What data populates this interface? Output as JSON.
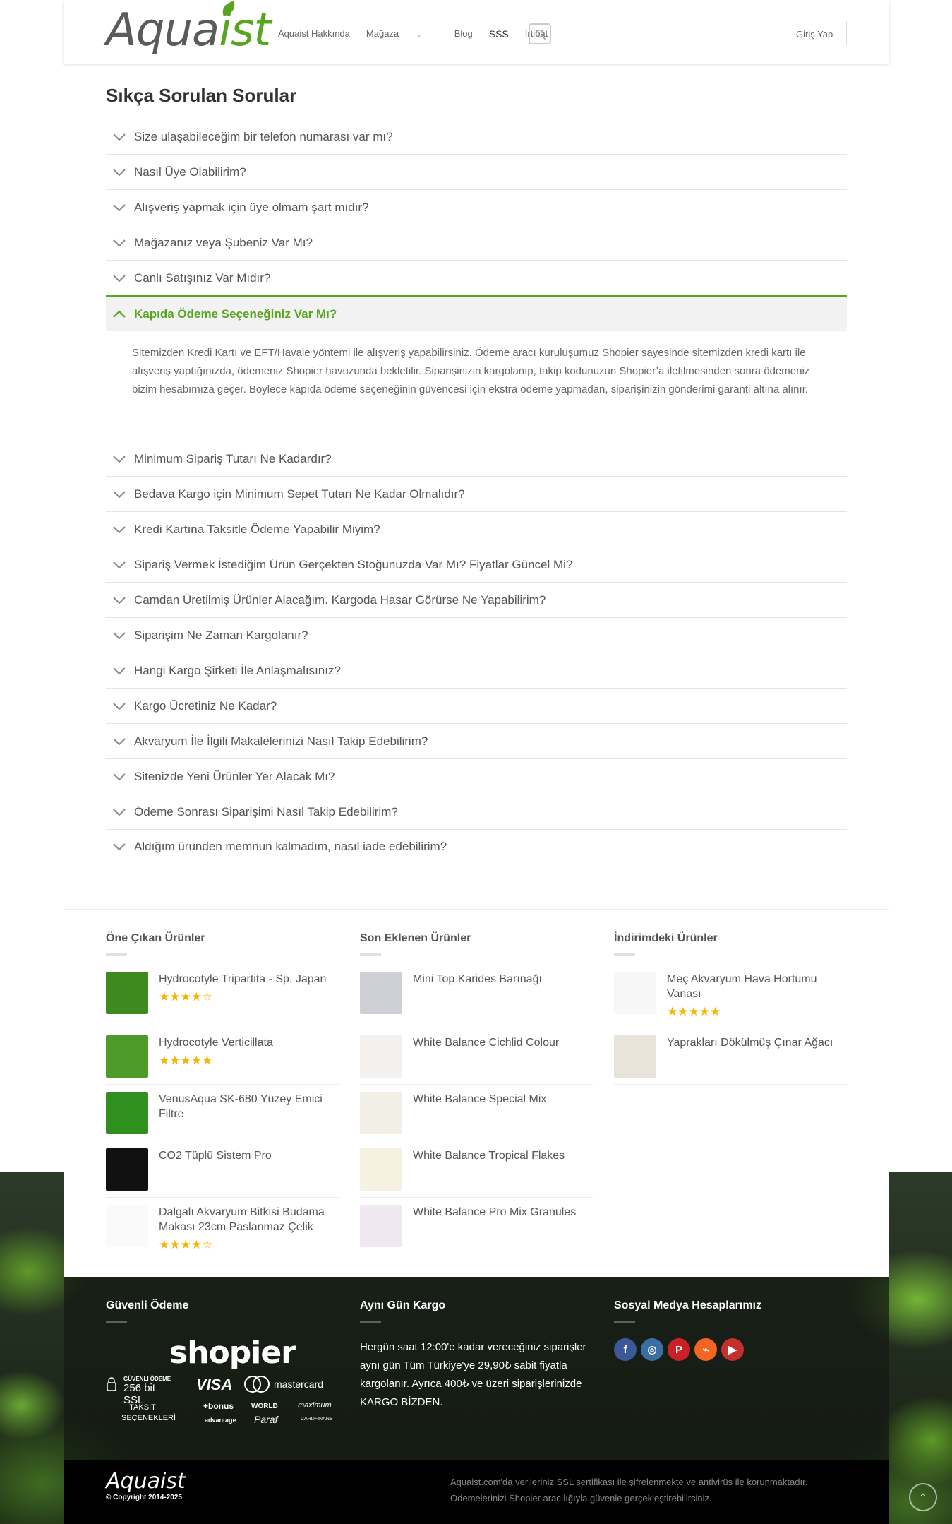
{
  "header": {
    "logo_text_a": "Aqua",
    "logo_text_b": "ist",
    "nav": [
      "Aquaist Hakkında",
      "Mağaza",
      "Blog",
      "SSS",
      "İrtibat"
    ],
    "login": "Giriş Yap"
  },
  "faq": {
    "title": "Sıkça Sorulan Sorular",
    "items_before": [
      "Size ulaşabileceğim bir telefon numarası var mı?",
      "Nasıl Üye Olabilirim?",
      "Alışveriş yapmak için üye olmam şart mıdır?",
      "Mağazanız veya Şubeniz Var Mı?",
      "Canlı Satışınız Var Mıdır?"
    ],
    "open_item": "Kapıda Ödeme Seçeneğiniz Var Mı?",
    "open_answer": "Sitemizden Kredi Kartı ve EFT/Havale yöntemi ile alışveriş yapabilirsiniz. Ödeme aracı kuruluşumuz Shopier sayesinde sitemizden kredi kartı ile alışveriş yaptığınızda, ödemeniz Shopier havuzunda bekletilir. Siparişinizin kargolanıp, takip kodunuzun Shopier’a iletilmesinden sonra ödemeniz bizim hesabımıza geçer. Böylece kapıda ödeme seçeneğinin güvencesi için ekstra ödeme yapmadan, siparişinizin gönderimi garanti altına alınır.",
    "items_after": [
      "Minimum Sipariş Tutarı Ne Kadardır?",
      "Bedava Kargo için Minimum Sepet Tutarı Ne Kadar Olmalıdır?",
      "Kredi Kartına Taksitle Ödeme Yapabilir Miyim?",
      "Sipariş Vermek İstediğim Ürün Gerçekten Stoğunuzda Var Mı? Fiyatlar Güncel Mi?",
      "Camdan Üretilmiş Ürünler Alacağım. Kargoda Hasar Görürse Ne Yapabilirim?",
      "Siparişim Ne Zaman Kargolanır?",
      "Hangi Kargo Şirketi İle Anlaşmalısınız?",
      "Kargo Ücretiniz Ne Kadar?",
      "Akvaryum İle İlgili Makalelerinizi Nasıl Takip Edebilirim?",
      "Sitenizde Yeni Ürünler Yer Alacak Mı?",
      "Ödeme Sonrası Siparişimi Nasıl Takip Edebilirim?",
      "Aldığım üründen memnun kalmadım, nasıl iade edebilirim?"
    ]
  },
  "widgets": {
    "featured": {
      "title": "Öne Çıkan Ürünler",
      "items": [
        {
          "name": "Hydrocotyle Tripartita - Sp. Japan",
          "rating": 4
        },
        {
          "name": "Hydrocotyle Verticillata",
          "rating": 5
        },
        {
          "name": "VenusAqua SK-680 Yüzey Emici Filtre",
          "rating": 0
        },
        {
          "name": "CO2 Tüplü Sistem Pro",
          "rating": 0
        },
        {
          "name": "Dalgalı Akvaryum Bitkisi Budama Makası 23cm Paslanmaz Çelik",
          "rating": 4
        }
      ]
    },
    "recent": {
      "title": "Son Eklenen Ürünler",
      "items": [
        {
          "name": "Mini Top Karides Barınağı"
        },
        {
          "name": "White Balance Cichlid Colour"
        },
        {
          "name": "White Balance Special Mix"
        },
        {
          "name": "White Balance Tropical Flakes"
        },
        {
          "name": "White Balance Pro Mix Granules"
        }
      ]
    },
    "sale": {
      "title": "İndirimdeki Ürünler",
      "items": [
        {
          "name": "Meç Akvaryum Hava Hortumu Vanası",
          "rating": 5
        },
        {
          "name": "Yaprakları Dökülmüş Çınar Ağacı",
          "rating": 0
        }
      ]
    }
  },
  "footer": {
    "secure_title": "Güvenli Ödeme",
    "shopier": "shopier",
    "ssl_small": "GÜVENLİ ÖDEME",
    "ssl_big": "256 bit SSL",
    "visa": "VISA",
    "mastercard": "mastercard",
    "taksit": "TAKSİT SEÇENEKLERİ",
    "cards": [
      "+bonus",
      "WORLD",
      "maximum",
      "advantage",
      "Paraf",
      "CARDFINANS"
    ],
    "cargo_title": "Aynı Gün Kargo",
    "cargo_text": "Hergün saat 12:00'e kadar vereceğiniz siparişler aynı gün Tüm Türkiye'ye 29,90₺ sabit fiyatla kargolanır. Ayrıca 400₺ ve üzeri siparişlerinizde KARGO BİZDEN.",
    "social_title": "Sosyal Medya Hesaplarımız",
    "social": [
      {
        "icon": "facebook-icon",
        "glyph": "f",
        "color": "#3b5998"
      },
      {
        "icon": "instagram-icon",
        "glyph": "◎",
        "color": "#3b6ea5"
      },
      {
        "icon": "pinterest-icon",
        "glyph": "P",
        "color": "#cb2027"
      },
      {
        "icon": "rss-icon",
        "glyph": "⌁",
        "color": "#f26522"
      },
      {
        "icon": "youtube-icon",
        "glyph": "▶",
        "color": "#c4302b"
      }
    ],
    "bottom_logo": "Aquaist",
    "copyright": "© Copyright 2014-2025",
    "bottom_text": "Aquaist.com'da verileriniz SSL sertifikası ile şifrelenmekte ve antivirüs ile korunmaktadır. Ödemelerinizi Shopier aracılığıyla güvenle gerçekleştirebilirsiniz."
  },
  "colors": {
    "brand_green": "#58a51f",
    "star": "#f4b400"
  }
}
